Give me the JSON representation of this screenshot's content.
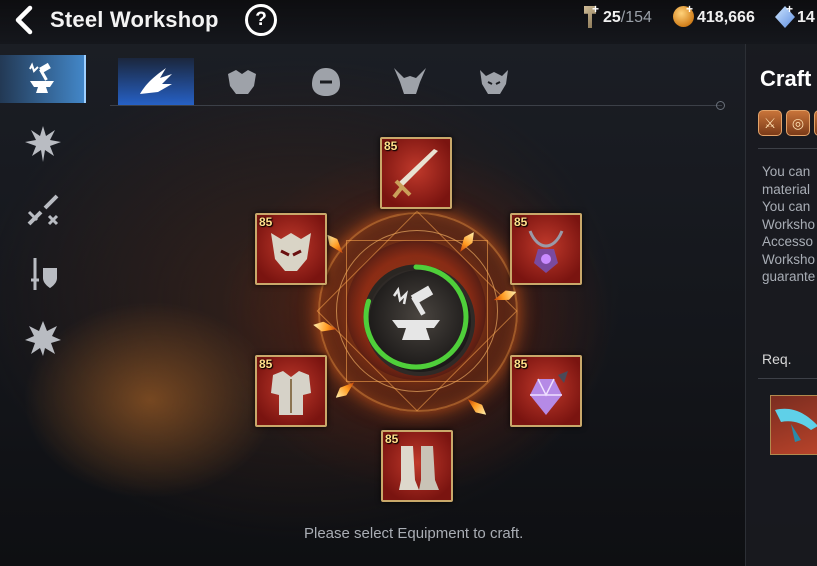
{
  "header": {
    "back_icon": "back-arrow-icon",
    "title": "Steel Workshop",
    "help_label": "?",
    "resources": [
      {
        "icon": "hammer-stamina-icon",
        "value": "25",
        "max": "/154"
      },
      {
        "icon": "gold-coin-icon",
        "value": "418,666"
      },
      {
        "icon": "crystal-gem-icon",
        "value": "14"
      }
    ]
  },
  "sidebar": {
    "items": [
      {
        "icon": "anvil-hammer-icon",
        "active": true
      },
      {
        "icon": "spiked-emblem-icon",
        "active": false
      },
      {
        "icon": "broken-sword-icon",
        "active": false
      },
      {
        "icon": "sword-shield-icon",
        "active": false
      },
      {
        "icon": "burst-emblem-icon",
        "active": false
      }
    ]
  },
  "tabs": [
    {
      "icon": "dragon-wing-icon",
      "active": true
    },
    {
      "icon": "beast-head-icon",
      "active": false
    },
    {
      "icon": "hooded-face-icon",
      "active": false
    },
    {
      "icon": "horned-demon-icon",
      "active": false
    },
    {
      "icon": "demon-lord-icon",
      "active": false
    }
  ],
  "workshop": {
    "center_icon": "anvil-craft-icon",
    "progress_fraction": 0.8,
    "slots": [
      {
        "name": "weapon",
        "level": "85",
        "icon": "great-sword-icon"
      },
      {
        "name": "helmet",
        "level": "85",
        "icon": "demon-helmet-icon"
      },
      {
        "name": "chest",
        "level": "85",
        "icon": "plate-armor-icon"
      },
      {
        "name": "boots",
        "level": "85",
        "icon": "armored-boots-icon"
      },
      {
        "name": "necklace",
        "level": "85",
        "icon": "amulet-icon"
      },
      {
        "name": "ring",
        "level": "85",
        "icon": "crystal-ring-icon"
      }
    ],
    "hint": "Please select Equipment to craft."
  },
  "right_panel": {
    "title": "Craft",
    "class_icons": [
      "sword-class-icon",
      "shield-class-icon",
      "class-icon"
    ],
    "description_lines": [
      "You can",
      "material",
      "You can",
      "Worksho",
      "Accesso",
      "Worksho",
      "guarante"
    ],
    "req_label": "Req.",
    "req_item_icon": "material-wing-icon"
  },
  "colors": {
    "accent_blue": "#4aa0ff",
    "progress_green": "#4fcf3a",
    "slot_red": "#b12a20",
    "slot_border": "#c9a86a"
  }
}
